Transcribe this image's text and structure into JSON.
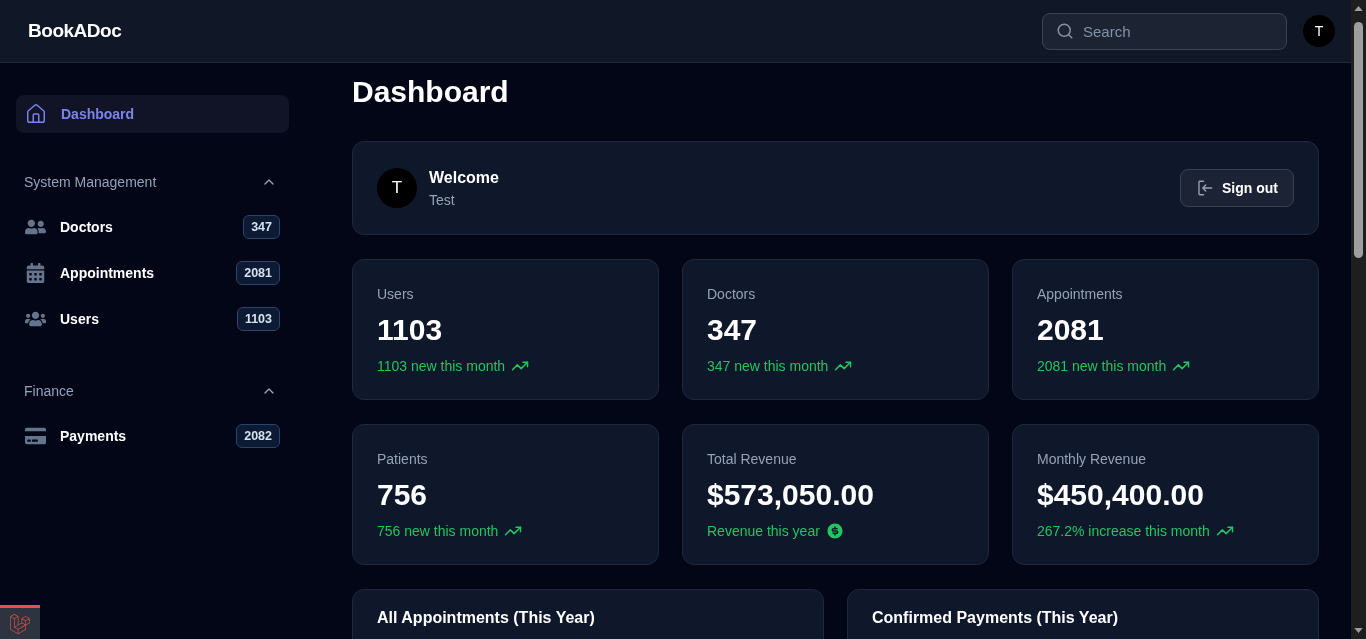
{
  "header": {
    "brand": "BookADoc",
    "search": {
      "placeholder": "Search"
    },
    "avatar": "T"
  },
  "sidebar": {
    "home": {
      "label": "Dashboard",
      "selected": true
    },
    "sections": [
      {
        "title": "System Management",
        "expanded": true,
        "items": [
          {
            "label": "Doctors",
            "count": "347",
            "selected": false
          },
          {
            "label": "Appointments",
            "count": "2081",
            "selected": false
          },
          {
            "label": "Users",
            "count": "1103",
            "selected": false
          }
        ]
      },
      {
        "title": "Finance",
        "expanded": true,
        "items": [
          {
            "label": "Payments",
            "count": "2082",
            "selected": false
          }
        ]
      }
    ]
  },
  "page_title": "Dashboard",
  "welcome": {
    "avatar": "T",
    "greeting": "Welcome",
    "name": "Test",
    "button": "Sign out"
  },
  "stats": [
    {
      "label": "Users",
      "value": "1103",
      "note": "1103 new this month",
      "kind": "trend"
    },
    {
      "label": "Doctors",
      "value": "347",
      "note": "347 new this month",
      "kind": "trend"
    },
    {
      "label": "Appointments",
      "value": "2081",
      "note": "2081 new this month",
      "kind": "trend"
    },
    {
      "label": "Patients",
      "value": "756",
      "note": "756 new this month",
      "kind": "trend"
    },
    {
      "label": "Total Revenue",
      "value": "$573,050.00",
      "note": "Revenue this year",
      "kind": "revenue"
    },
    {
      "label": "Monthly Revenue",
      "value": "$450,400.00",
      "note": "267.2% increase this month",
      "kind": "trend"
    }
  ],
  "panels": [
    {
      "title": "All Appointments (This Year)"
    },
    {
      "title": "Confirmed Payments (This Year)"
    }
  ]
}
